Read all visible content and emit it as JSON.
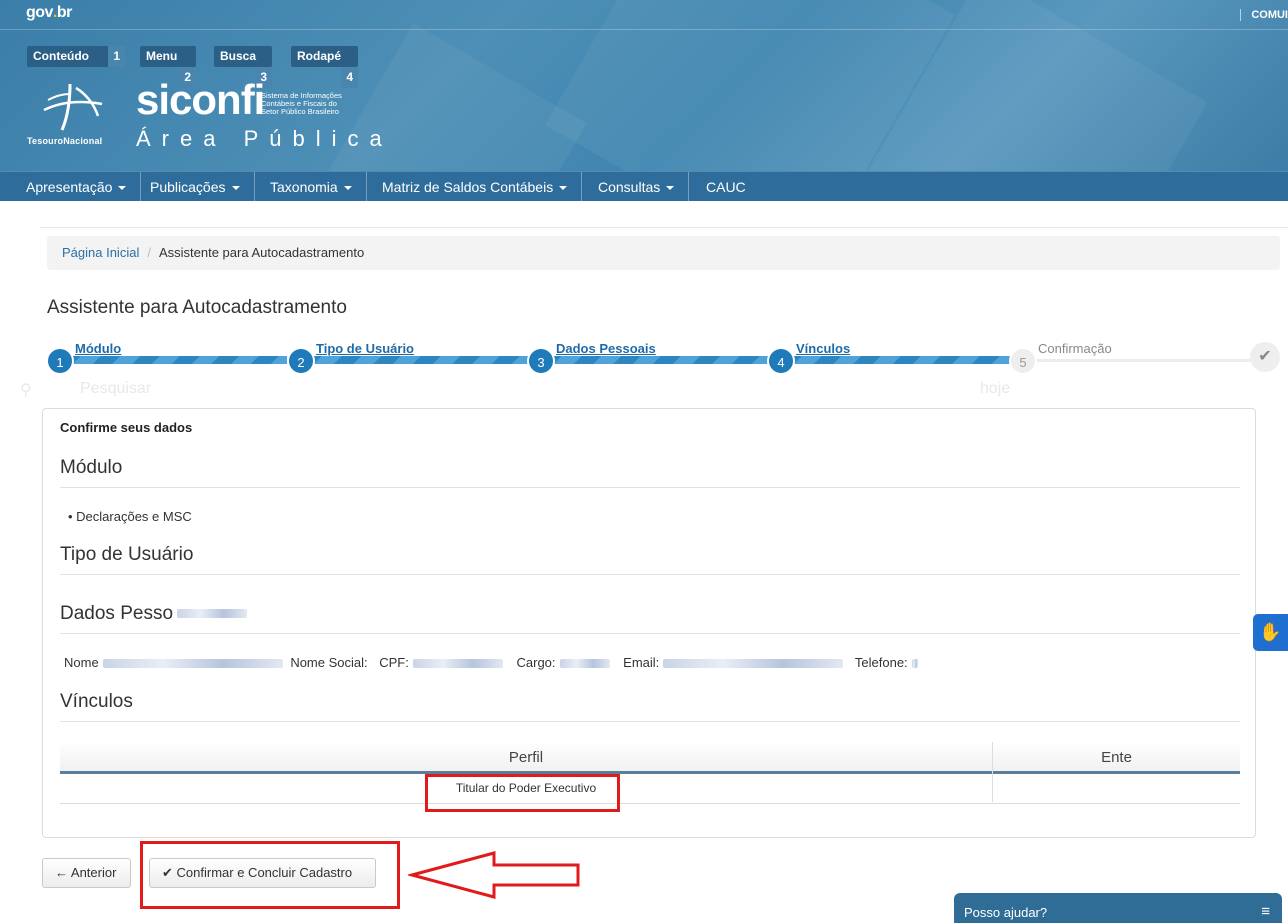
{
  "gov": {
    "brand_prefix": "gov",
    "brand_dot": ".",
    "brand_suffix": "br",
    "right_link": "COMUI"
  },
  "skip_links": [
    {
      "label": "Conteúdo",
      "key": "1"
    },
    {
      "label": "Menu",
      "key": "2"
    },
    {
      "label": "Busca",
      "key": "3"
    },
    {
      "label": "Rodapé",
      "key": "4"
    }
  ],
  "logo": {
    "tesouro": "TesouroNacional",
    "siconfi": "siconfi",
    "siconfi_sub_1": "Sistema de Informações",
    "siconfi_sub_2": "Contábeis e Fiscais do",
    "siconfi_sub_3": "Setor Público Brasileiro",
    "area": "Área Pública"
  },
  "nav": [
    {
      "label": "Apresentação"
    },
    {
      "label": "Publicações"
    },
    {
      "label": "Taxonomia"
    },
    {
      "label": "Matriz de Saldos Contábeis"
    },
    {
      "label": "Consultas"
    },
    {
      "label": "CAUC"
    }
  ],
  "breadcrumb": {
    "home": "Página Inicial",
    "current": "Assistente para Autocadastramento"
  },
  "page_title": "Assistente para Autocadastramento",
  "wizard": {
    "steps": [
      {
        "num": "1",
        "label": "Módulo"
      },
      {
        "num": "2",
        "label": "Tipo de Usuário"
      },
      {
        "num": "3",
        "label": "Dados Pessoais"
      },
      {
        "num": "4",
        "label": "Vínculos"
      },
      {
        "num": "5",
        "label": "Confirmação"
      }
    ],
    "done_icon": "check-icon"
  },
  "ghost": {
    "search": "Pesquisar",
    "hoje": "hoje"
  },
  "panel": {
    "heading": "Confirme seus dados",
    "modulo_title": "Módulo",
    "modulo_item": "Declarações e MSC",
    "tipo_title": "Tipo de Usuário",
    "dados_title": "Dados Pesso",
    "fields": {
      "nome": "Nome",
      "nome_social": "Nome Social:",
      "cpf": "CPF:",
      "cargo": "Cargo:",
      "email": "Email:",
      "telefone": "Telefone:"
    },
    "vinculos_title": "Vínculos",
    "table": {
      "headers": [
        "Perfil",
        "Ente"
      ],
      "rows": [
        {
          "perfil": "Titular do Poder Executivo",
          "ente": ""
        }
      ]
    }
  },
  "buttons": {
    "back": "Anterior",
    "confirm": "Confirmar e Concluir Cadastro"
  },
  "help": {
    "label": "Posso ajudar?"
  },
  "accent": {
    "primary": "#1e7ab8",
    "annotation_red": "#e11b1b",
    "header_blue": "#3f85b0"
  }
}
